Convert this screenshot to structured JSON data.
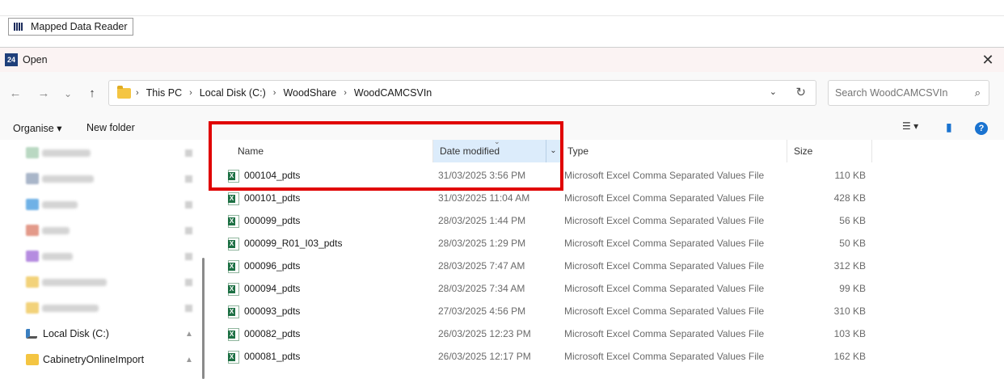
{
  "app_tab": {
    "label": "Mapped Data Reader"
  },
  "dialog": {
    "title": "Open",
    "icon_text": "24",
    "close_glyph": "✕"
  },
  "nav": {
    "back_icon": "←",
    "forward_icon": "→",
    "recent_icon": "⌄",
    "up_icon": "↑"
  },
  "address": {
    "crumbs": [
      "This PC",
      "Local Disk (C:)",
      "WoodShare",
      "WoodCAMCSVIn"
    ],
    "sep": "›",
    "drop": "⌄",
    "refresh": "↻"
  },
  "search": {
    "placeholder": "Search WoodCAMCSVIn",
    "icon": "⌕"
  },
  "toolbar": {
    "organise": "Organise ▾",
    "new_folder": "New folder",
    "view_icon": "☰ ▾",
    "pane_icon": "▮",
    "help": "?"
  },
  "sidebar": {
    "items": [
      {
        "label": "Local Disk (C:)",
        "icon": "drive-icon",
        "pin": "📌"
      },
      {
        "label": "CabinetryOnlineImport",
        "icon": "folder-icon",
        "pin": "📌"
      }
    ]
  },
  "columns": {
    "name": "Name",
    "date": "Date modified",
    "type": "Type",
    "size": "Size",
    "sort_caret": "⌄",
    "split_caret": "⌄"
  },
  "files": [
    {
      "name": "000104_pdts",
      "date": "31/03/2025 3:56 PM",
      "type": "Microsoft Excel Comma Separated Values File",
      "size": "110 KB"
    },
    {
      "name": "000101_pdts",
      "date": "31/03/2025 11:04 AM",
      "type": "Microsoft Excel Comma Separated Values File",
      "size": "428 KB"
    },
    {
      "name": "000099_pdts",
      "date": "28/03/2025 1:44 PM",
      "type": "Microsoft Excel Comma Separated Values File",
      "size": "56 KB"
    },
    {
      "name": "000099_R01_I03_pdts",
      "date": "28/03/2025 1:29 PM",
      "type": "Microsoft Excel Comma Separated Values File",
      "size": "50 KB"
    },
    {
      "name": "000096_pdts",
      "date": "28/03/2025 7:47 AM",
      "type": "Microsoft Excel Comma Separated Values File",
      "size": "312 KB"
    },
    {
      "name": "000094_pdts",
      "date": "28/03/2025 7:34 AM",
      "type": "Microsoft Excel Comma Separated Values File",
      "size": "99 KB"
    },
    {
      "name": "000093_pdts",
      "date": "27/03/2025 4:56 PM",
      "type": "Microsoft Excel Comma Separated Values File",
      "size": "310 KB"
    },
    {
      "name": "000082_pdts",
      "date": "26/03/2025 12:23 PM",
      "type": "Microsoft Excel Comma Separated Values File",
      "size": "103 KB"
    },
    {
      "name": "000081_pdts",
      "date": "26/03/2025 12:17 PM",
      "type": "Microsoft Excel Comma Separated Values File",
      "size": "162 KB"
    }
  ],
  "colors": {
    "highlight": "#e00000",
    "sorted_column": "#dcecfb",
    "excel_green": "#1d7044"
  }
}
